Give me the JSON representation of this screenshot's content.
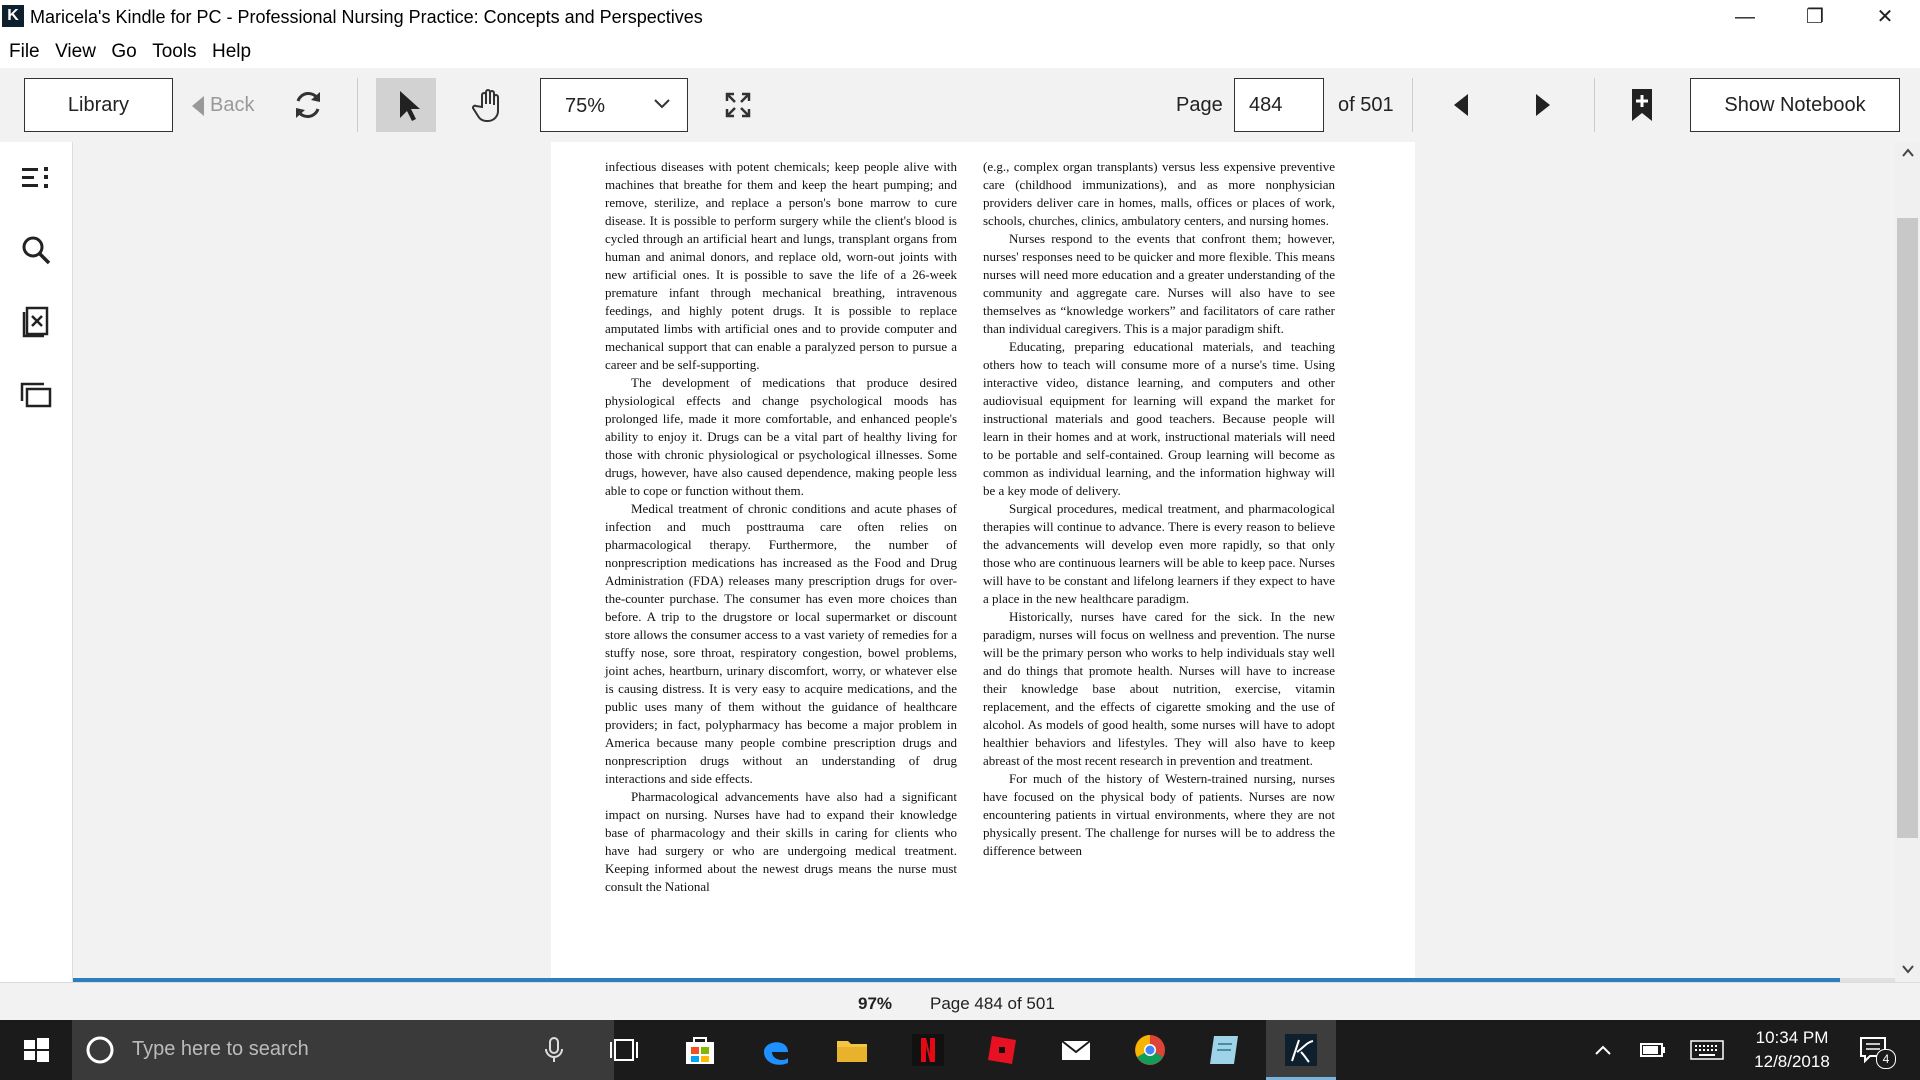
{
  "window": {
    "title": "Maricela's Kindle for PC - Professional Nursing Practice: Concepts and Perspectives",
    "app_icon_letter": "K"
  },
  "menu": [
    "File",
    "View",
    "Go",
    "Tools",
    "Help"
  ],
  "toolbar": {
    "library_label": "Library",
    "back_label": "Back",
    "zoom_value": "75%",
    "page_label": "Page",
    "page_input": "484",
    "page_total": "of 501",
    "show_notebook_label": "Show Notebook"
  },
  "book": {
    "left_column": [
      {
        "indent": false,
        "text": "infectious diseases with potent chemicals; keep people alive with machines that breathe for them and keep the heart pumping; and remove, sterilize, and replace a person's bone marrow to cure disease. It is possible to perform surgery while the client's blood is cycled through an artificial heart and lungs, transplant organs from human and animal donors, and replace old, worn-out joints with new artificial ones. It is possible to save the life of a 26-week premature infant through mechanical breathing, intravenous feedings, and highly potent drugs. It is possible to replace amputated limbs with artificial ones and to provide computer and mechanical support that can enable a paralyzed person to pursue a career and be self-supporting."
      },
      {
        "indent": true,
        "text": "The development of medications that produce desired physiological effects and change psychological moods has prolonged life, made it more comfortable, and enhanced people's ability to enjoy it. Drugs can be a vital part of healthy living for those with chronic physiological or psychological illnesses. Some drugs, however, have also caused dependence, making people less able to cope or function without them."
      },
      {
        "indent": true,
        "text": "Medical treatment of chronic conditions and acute phases of infection and much posttrauma care often relies on pharmacological therapy. Furthermore, the number of nonprescription medications has increased as the Food and Drug Administration (FDA) releases many prescription drugs for over-the-counter purchase. The consumer has even more choices than before. A trip to the drugstore or local supermarket or discount store allows the consumer access to a vast variety of remedies for a stuffy nose, sore throat, respiratory congestion, bowel problems, joint aches, heartburn, urinary discomfort, worry, or whatever else is causing distress. It is very easy to acquire medications, and the public uses many of them without the guidance of healthcare providers; in fact, polypharmacy has become a major problem in America because many people combine prescription drugs and nonprescription drugs without an understanding of drug interactions and side effects."
      },
      {
        "indent": true,
        "text": "Pharmacological advancements have also had a significant impact on nursing. Nurses have had to expand their knowledge base of pharmacology and their skills in caring for clients who have had surgery or who are undergoing medical treatment. Keeping informed about the newest drugs means the nurse must consult the National"
      }
    ],
    "right_column": [
      {
        "indent": false,
        "text": "(e.g., complex organ transplants) versus less expensive preventive care (childhood immunizations), and as more nonphysician providers deliver care in homes, malls, offices or places of work, schools, churches, clinics, ambulatory centers, and nursing homes."
      },
      {
        "indent": true,
        "text": "Nurses respond to the events that confront them; however, nurses' responses need to be quicker and more flexible. This means nurses will need more education and a greater understanding of the community and aggregate care. Nurses will also have to see themselves as “knowledge workers” and facilitators of care rather than individual caregivers. This is a major paradigm shift."
      },
      {
        "indent": true,
        "text": "Educating, preparing educational materials, and teaching others how to teach will consume more of a nurse's time. Using interactive video, distance learning, and computers and other audiovisual equipment for learning will expand the market for instructional materials and good teachers. Because people will learn in their homes and at work, instructional materials will need to be portable and self-contained. Group learning will become as common as individual learning, and the information highway will be a key mode of delivery."
      },
      {
        "indent": true,
        "text": "Surgical procedures, medical treatment, and pharmacological therapies will continue to advance. There is every reason to believe the advancements will develop even more rapidly, so that only those who are continuous learners will be able to keep pace. Nurses will have to be constant and lifelong learners if they expect to have a place in the new healthcare paradigm."
      },
      {
        "indent": true,
        "text": "Historically, nurses have cared for the sick. In the new paradigm, nurses will focus on wellness and prevention. The nurse will be the primary person who works to help individuals stay well and do things that promote health. Nurses will have to increase their knowledge base about nutrition, exercise, vitamin replacement, and the effects of cigarette smoking and the use of alcohol. As models of good health, some nurses will have to adopt healthier behaviors and lifestyles. They will also have to keep abreast of the most recent research in prevention and treatment."
      },
      {
        "indent": true,
        "text": "For much of the history of Western-trained nursing, nurses have focused on the physical body of patients. Nurses are now encountering patients in virtual environments, where they are not physically present. The challenge for nurses will be to address the difference between"
      }
    ]
  },
  "status": {
    "percent": "97%",
    "progress_value": 0.97,
    "page_text": "Page 484 of 501"
  },
  "taskbar": {
    "search_placeholder": "Type here to search",
    "time": "10:34 PM",
    "date": "12/8/2018",
    "notification_count": "4"
  },
  "colors": {
    "accent": "#2e7dbd",
    "taskbar": "#1b1b1b",
    "toolbar": "#f2f2f2"
  }
}
